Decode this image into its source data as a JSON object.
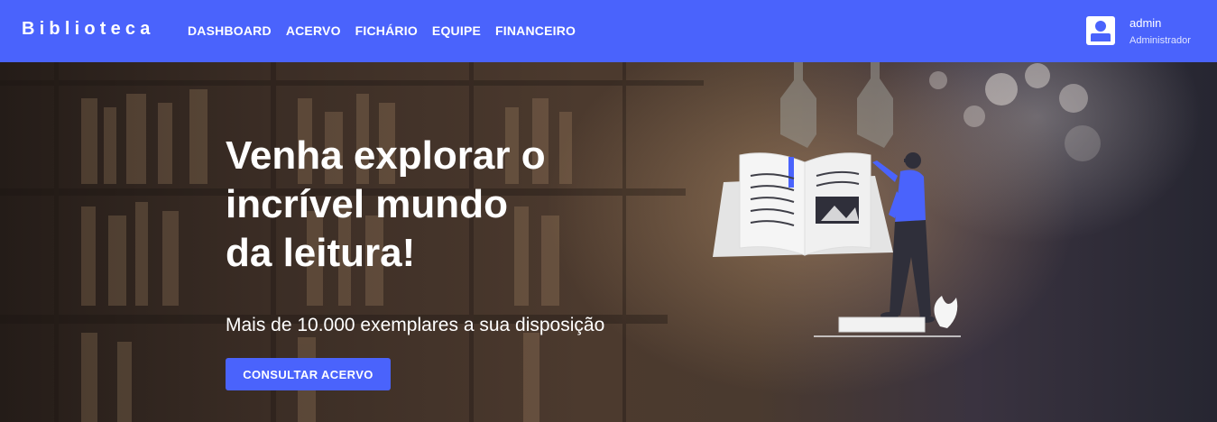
{
  "navbar": {
    "brand": "Biblioteca",
    "links": [
      "DASHBOARD",
      "ACERVO",
      "FICHÁRIO",
      "EQUIPE",
      "FINANCEIRO"
    ],
    "user": {
      "name": "admin",
      "role": "Administrador",
      "icon": "user-avatar-icon"
    }
  },
  "hero": {
    "title_lines": [
      "Venha explorar o",
      "incrível mundo",
      "da leitura!"
    ],
    "subtitle": "Mais de 10.000 exemplares a sua disposição",
    "cta_label": "CONSULTAR ACERVO",
    "illustration": "woman-reading-giant-book-illustration"
  },
  "colors": {
    "primary": "#4a63fc",
    "text_light": "#ffffff"
  }
}
